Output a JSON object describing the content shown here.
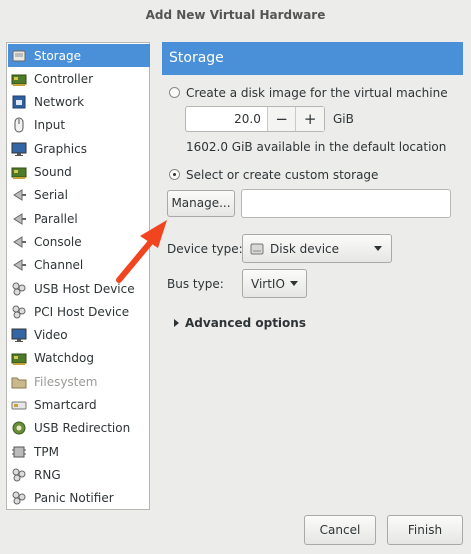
{
  "window": {
    "title": "Add New Virtual Hardware"
  },
  "sidebar": {
    "items": [
      {
        "label": "Storage",
        "icon": "storage-icon",
        "selected": true
      },
      {
        "label": "Controller",
        "icon": "controller-icon"
      },
      {
        "label": "Network",
        "icon": "network-icon"
      },
      {
        "label": "Input",
        "icon": "mouse-icon"
      },
      {
        "label": "Graphics",
        "icon": "monitor-icon"
      },
      {
        "label": "Sound",
        "icon": "sound-card-icon"
      },
      {
        "label": "Serial",
        "icon": "serial-plug-icon"
      },
      {
        "label": "Parallel",
        "icon": "parallel-plug-icon"
      },
      {
        "label": "Console",
        "icon": "console-plug-icon"
      },
      {
        "label": "Channel",
        "icon": "channel-plug-icon"
      },
      {
        "label": "USB Host Device",
        "icon": "usb-host-icon"
      },
      {
        "label": "PCI Host Device",
        "icon": "pci-host-icon"
      },
      {
        "label": "Video",
        "icon": "video-monitor-icon"
      },
      {
        "label": "Watchdog",
        "icon": "watchdog-icon"
      },
      {
        "label": "Filesystem",
        "icon": "folder-icon",
        "disabled": true
      },
      {
        "label": "Smartcard",
        "icon": "smartcard-icon"
      },
      {
        "label": "USB Redirection",
        "icon": "usb-redirection-icon"
      },
      {
        "label": "TPM",
        "icon": "tpm-chip-icon"
      },
      {
        "label": "RNG",
        "icon": "rng-icon"
      },
      {
        "label": "Panic Notifier",
        "icon": "panic-notifier-icon"
      }
    ]
  },
  "main": {
    "header": "Storage",
    "create_disk_label": "Create a disk image for the virtual machine",
    "disk_size_value": "20.0",
    "disk_size_unit": "GiB",
    "minus_label": "−",
    "plus_label": "+",
    "available_text": "1602.0 GiB available in the default location",
    "custom_storage_label": "Select or create custom storage",
    "manage_label": "Manage...",
    "storage_path_value": "",
    "device_type_label": "Device type:",
    "device_type_value": "Disk device",
    "bus_type_label": "Bus type:",
    "bus_type_value": "VirtIO",
    "advanced_label": "Advanced options"
  },
  "footer": {
    "cancel_label": "Cancel",
    "finish_label": "Finish"
  },
  "colors": {
    "selection": "#4a90d9",
    "annotation_arrow": "#f0451f"
  }
}
